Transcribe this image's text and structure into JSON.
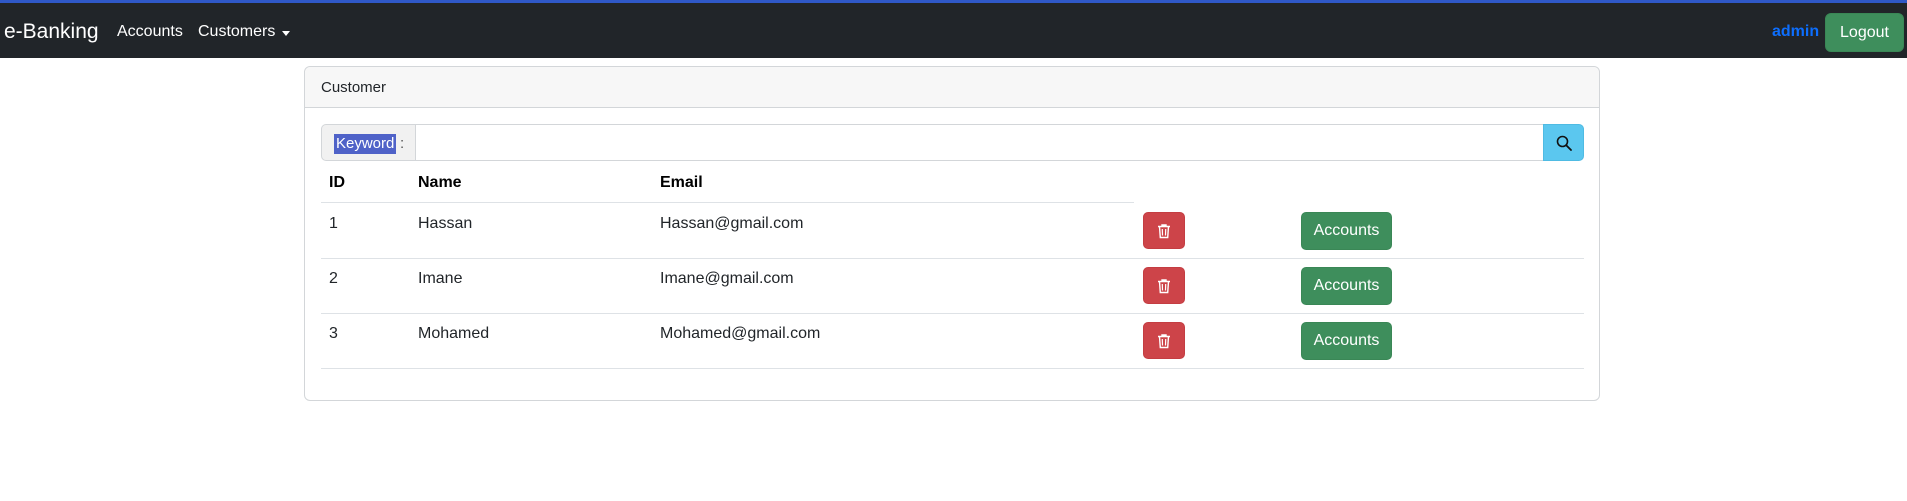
{
  "navbar": {
    "brand": "e-Banking",
    "items": [
      {
        "label": "Accounts"
      },
      {
        "label": "Customers"
      }
    ],
    "user": "admin",
    "logout_label": "Logout"
  },
  "card": {
    "title": "Customer",
    "search": {
      "label": "Keyword",
      "colon": ":",
      "value": "",
      "placeholder": ""
    },
    "table": {
      "columns": [
        "ID",
        "Name",
        "Email"
      ],
      "rows": [
        {
          "id": "1",
          "name": "Hassan",
          "email": "Hassan@gmail.com",
          "accounts_label": "Accounts"
        },
        {
          "id": "2",
          "name": "Imane",
          "email": "Imane@gmail.com",
          "accounts_label": "Accounts"
        },
        {
          "id": "3",
          "name": "Mohamed",
          "email": "Mohamed@gmail.com",
          "accounts_label": "Accounts"
        }
      ]
    }
  },
  "icons": {
    "search": "search-icon",
    "delete": "trash-icon",
    "dropdown": "caret-down-icon"
  },
  "colors": {
    "navbar_bg": "#212529",
    "user": "#0d6efd",
    "success": "#3e8e5c",
    "danger": "#cd4449",
    "info": "#5bc7ef"
  }
}
